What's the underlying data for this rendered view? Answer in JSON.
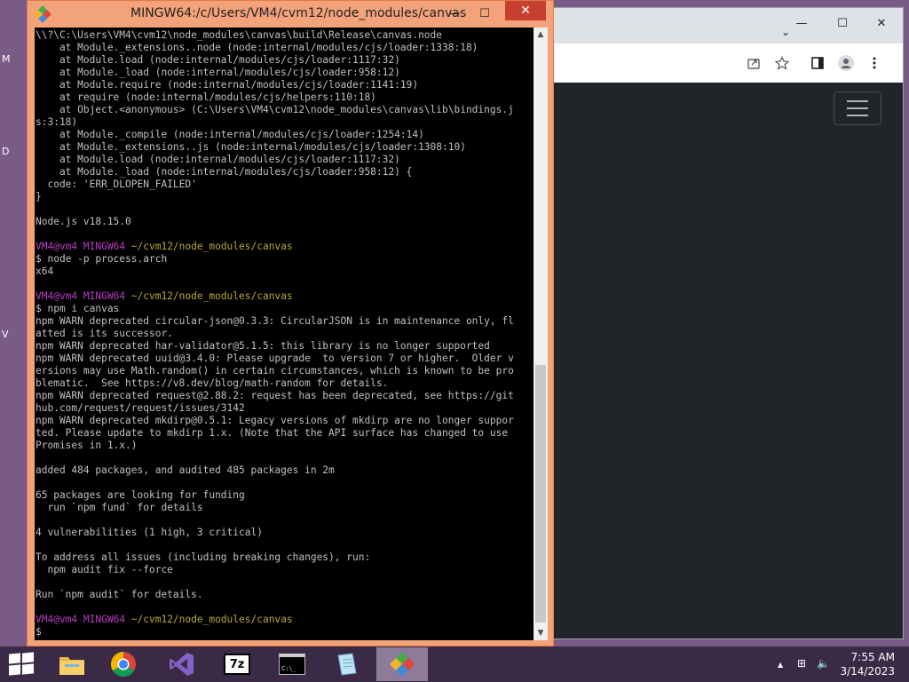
{
  "desktop": {
    "glyphs": [
      "M",
      "D",
      "V"
    ]
  },
  "browser": {
    "controls": {
      "minimize": "—",
      "maximize": "☐",
      "close": "✕",
      "tab_dropdown": "⌄"
    },
    "toolbar_icons": [
      "share-icon",
      "star-icon",
      "sidebar-icon",
      "profile-icon",
      "menu-dots-icon"
    ]
  },
  "terminal": {
    "title": "MINGW64:/c/Users/VM4/cvm12/node_modules/canvas",
    "controls": {
      "minimize": "—",
      "maximize": "☐",
      "close": "✕"
    },
    "prompt": {
      "user": "VM4@vm4",
      "host": "MINGW64",
      "path": "~/cvm12/node_modules/canvas"
    },
    "lines": [
      "\\\\?\\C:\\Users\\VM4\\cvm12\\node_modules\\canvas\\build\\Release\\canvas.node",
      "    at Module._extensions..node (node:internal/modules/cjs/loader:1338:18)",
      "    at Module.load (node:internal/modules/cjs/loader:1117:32)",
      "    at Module._load (node:internal/modules/cjs/loader:958:12)",
      "    at Module.require (node:internal/modules/cjs/loader:1141:19)",
      "    at require (node:internal/modules/cjs/helpers:110:18)",
      "    at Object.<anonymous> (C:\\Users\\VM4\\cvm12\\node_modules\\canvas\\lib\\bindings.j",
      "s:3:18)",
      "    at Module._compile (node:internal/modules/cjs/loader:1254:14)",
      "    at Module._extensions..js (node:internal/modules/cjs/loader:1308:10)",
      "    at Module.load (node:internal/modules/cjs/loader:1117:32)",
      "    at Module._load (node:internal/modules/cjs/loader:958:12) {",
      "  code: 'ERR_DLOPEN_FAILED'",
      "}",
      "",
      "Node.js v18.15.0",
      "",
      "__PROMPT__",
      "$ node -p process.arch",
      "x64",
      "",
      "__PROMPT__",
      "$ npm i canvas",
      "npm WARN deprecated circular-json@0.3.3: CircularJSON is in maintenance only, fl",
      "atted is its successor.",
      "npm WARN deprecated har-validator@5.1.5: this library is no longer supported",
      "npm WARN deprecated uuid@3.4.0: Please upgrade  to version 7 or higher.  Older v",
      "ersions may use Math.random() in certain circumstances, which is known to be pro",
      "blematic.  See https://v8.dev/blog/math-random for details.",
      "npm WARN deprecated request@2.88.2: request has been deprecated, see https://git",
      "hub.com/request/request/issues/3142",
      "npm WARN deprecated mkdirp@0.5.1: Legacy versions of mkdirp are no longer suppor",
      "ted. Please update to mkdirp 1.x. (Note that the API surface has changed to use",
      "Promises in 1.x.)",
      "",
      "added 484 packages, and audited 485 packages in 2m",
      "",
      "65 packages are looking for funding",
      "  run `npm fund` for details",
      "",
      "4 vulnerabilities (1 high, 3 critical)",
      "",
      "To address all issues (including breaking changes), run:",
      "  npm audit fix --force",
      "",
      "Run `npm audit` for details.",
      "",
      "__PROMPT__",
      "$"
    ],
    "scroll_up": "▲",
    "scroll_down": "▼"
  },
  "taskbar": {
    "items": [
      {
        "name": "file-explorer-icon",
        "active": false
      },
      {
        "name": "chrome-icon",
        "active": false
      },
      {
        "name": "visual-studio-icon",
        "active": false
      },
      {
        "name": "7zip-icon",
        "active": false
      },
      {
        "name": "command-prompt-icon",
        "active": false
      },
      {
        "name": "notepad-icon",
        "active": false
      },
      {
        "name": "git-bash-icon",
        "active": true
      }
    ],
    "seven_zip_label": "7z",
    "cmd_label": "C:\\_",
    "tray": {
      "chevron": "▲",
      "network": "⊞",
      "volume": "🔈"
    },
    "clock": {
      "time": "7:55 AM",
      "date": "3/14/2023"
    }
  }
}
